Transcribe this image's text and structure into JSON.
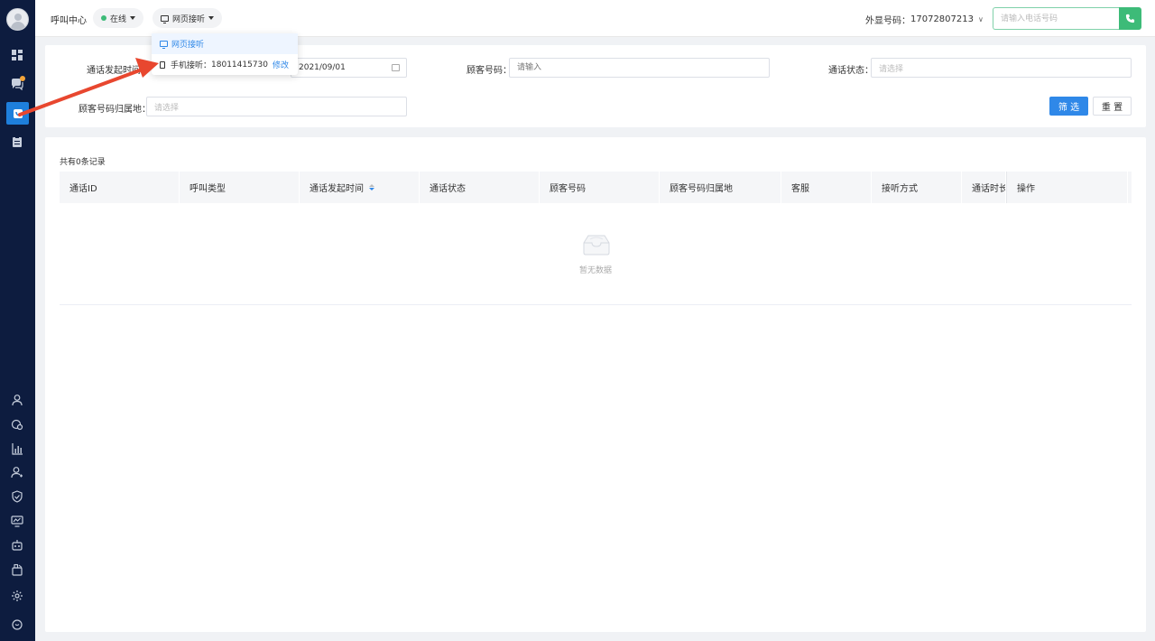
{
  "topbar": {
    "title": "呼叫中心",
    "status_label": "在线",
    "mode_label": "网页接听",
    "caller_label": "外显号码：",
    "caller_number": "17072807213",
    "phone_placeholder": "请输入电话号码"
  },
  "dropdown": {
    "web_option": "网页接听",
    "mobile_label": "手机接听：",
    "mobile_number": "18011415730",
    "edit_label": "修改"
  },
  "filters": {
    "call_time_label": "通话发起时间",
    "call_time_value": "2021/09/01",
    "customer_number_label": "顾客号码：",
    "customer_number_placeholder": "请输入",
    "call_status_label": "通话状态：",
    "call_status_placeholder": "请选择",
    "location_label": "顾客号码归属地：",
    "location_placeholder": "请选择",
    "filter_button": "筛 选",
    "reset_button": "重 置"
  },
  "table": {
    "record_count": "共有0条记录",
    "columns": [
      "通话ID",
      "呼叫类型",
      "通话发起时间",
      "通话状态",
      "顾客号码",
      "顾客号码归属地",
      "客服",
      "接听方式",
      "通话时长",
      "操作"
    ],
    "empty_text": "暂无数据"
  },
  "sidebar": {
    "icons": [
      "dashboard-icon",
      "chat-icon",
      "call-center-icon",
      "clipboard-icon",
      "user-icon",
      "customer-icon",
      "chart-icon",
      "team-icon",
      "shield-icon",
      "monitor-icon",
      "robot-icon",
      "plugin-icon",
      "gear-icon",
      "message-icon"
    ]
  },
  "colors": {
    "sidebar_bg": "#0d1c3f",
    "primary": "#2f88e8",
    "success": "#3dbb78",
    "annotation_arrow": "#e8472f"
  }
}
